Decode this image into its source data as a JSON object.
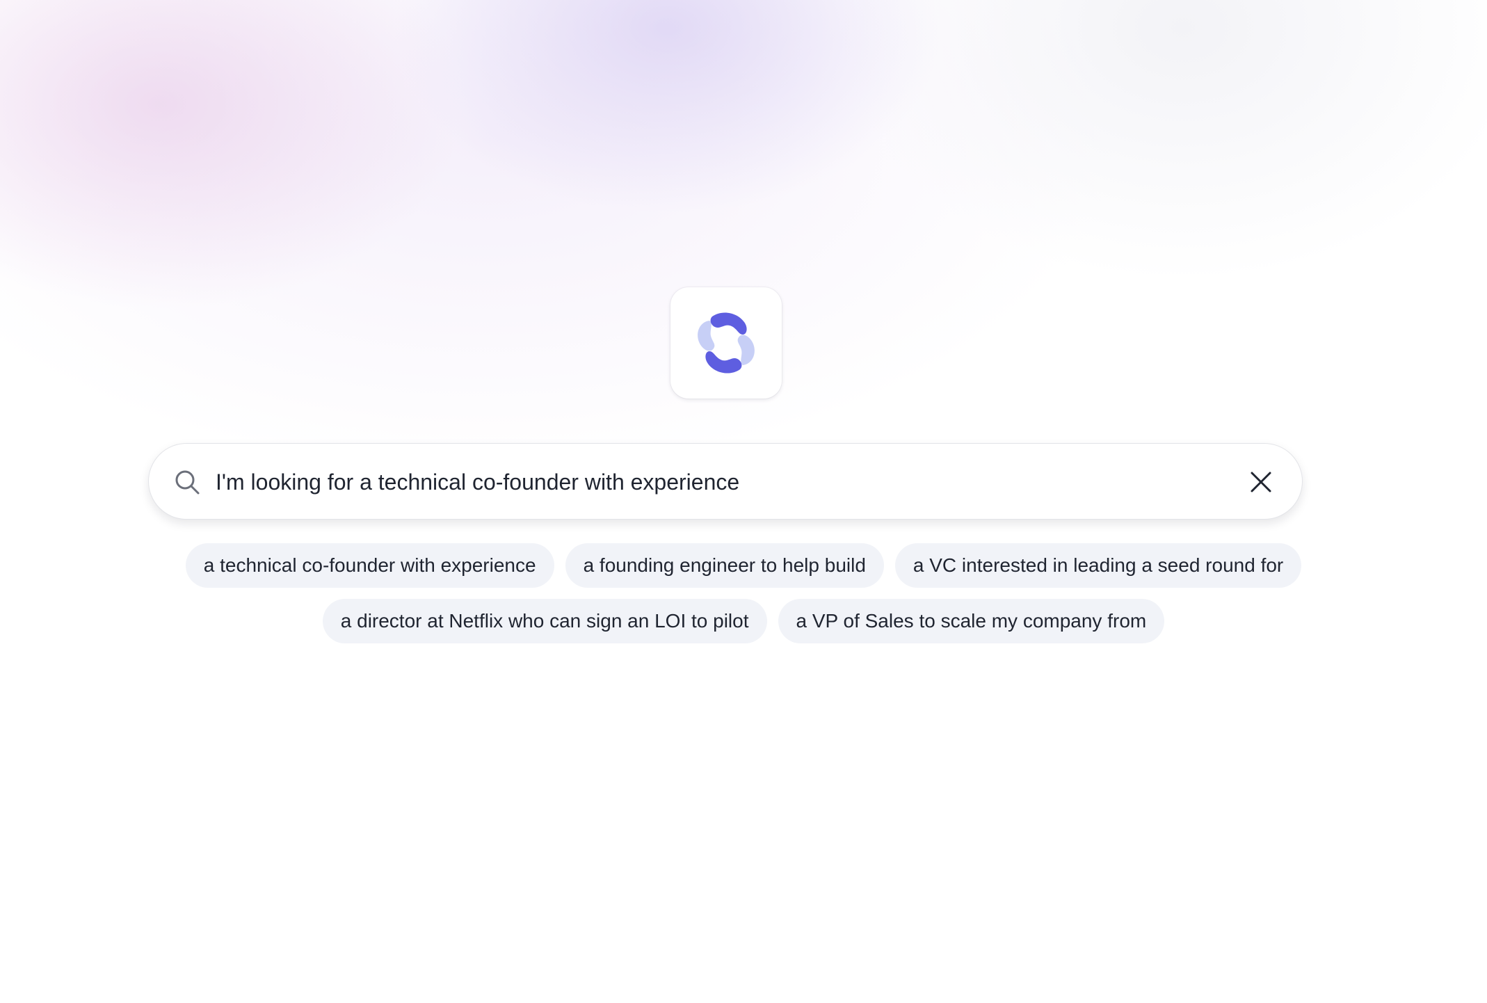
{
  "brand": {
    "logo_icon": "loop-arrows-icon",
    "accent_color": "#5e5ee0",
    "accent_light_color": "#c7cff6"
  },
  "search": {
    "value": "I'm looking for a technical co-founder with experience",
    "search_icon": "search-icon",
    "clear_icon": "close-icon"
  },
  "suggestions": {
    "row1": [
      "a technical co-founder with experience",
      "a founding engineer to help build",
      "a VC interested in leading a seed round for"
    ],
    "row2": [
      "a director at Netflix who can sign an LOI to pilot",
      "a VP of Sales to scale my company from"
    ]
  }
}
